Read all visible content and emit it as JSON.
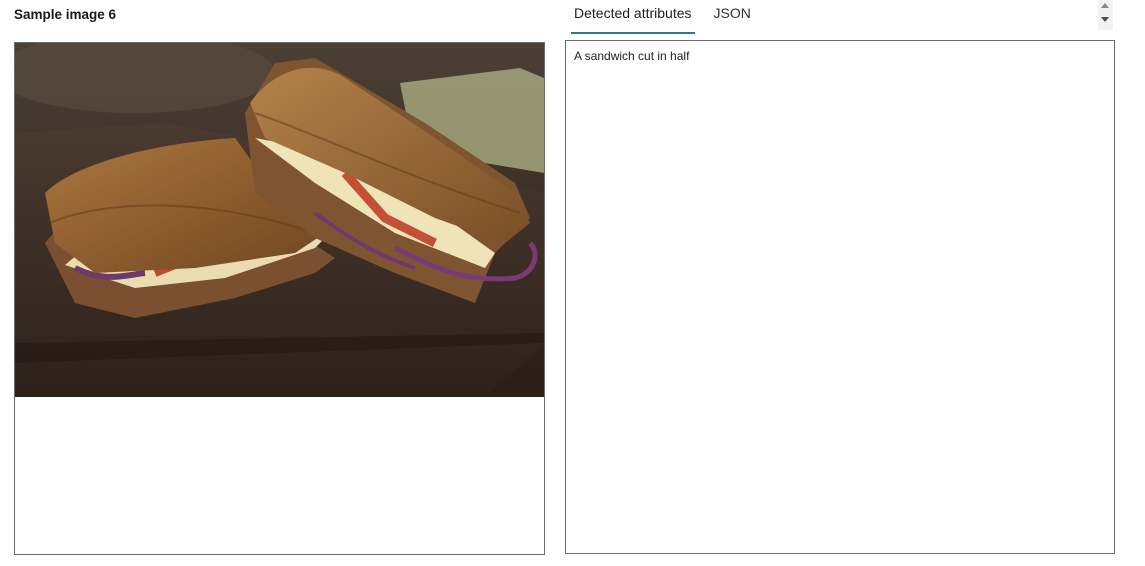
{
  "left_panel": {
    "title": "Sample image 6",
    "image_alt": "A sandwich cut in half"
  },
  "right_panel": {
    "tabs": [
      {
        "label": "Detected attributes",
        "active": true
      },
      {
        "label": "JSON",
        "active": false
      }
    ],
    "detected_text": "A sandwich cut in half"
  },
  "colors": {
    "tab_underline": "#2b7a86",
    "border": "#6b6b6b"
  }
}
